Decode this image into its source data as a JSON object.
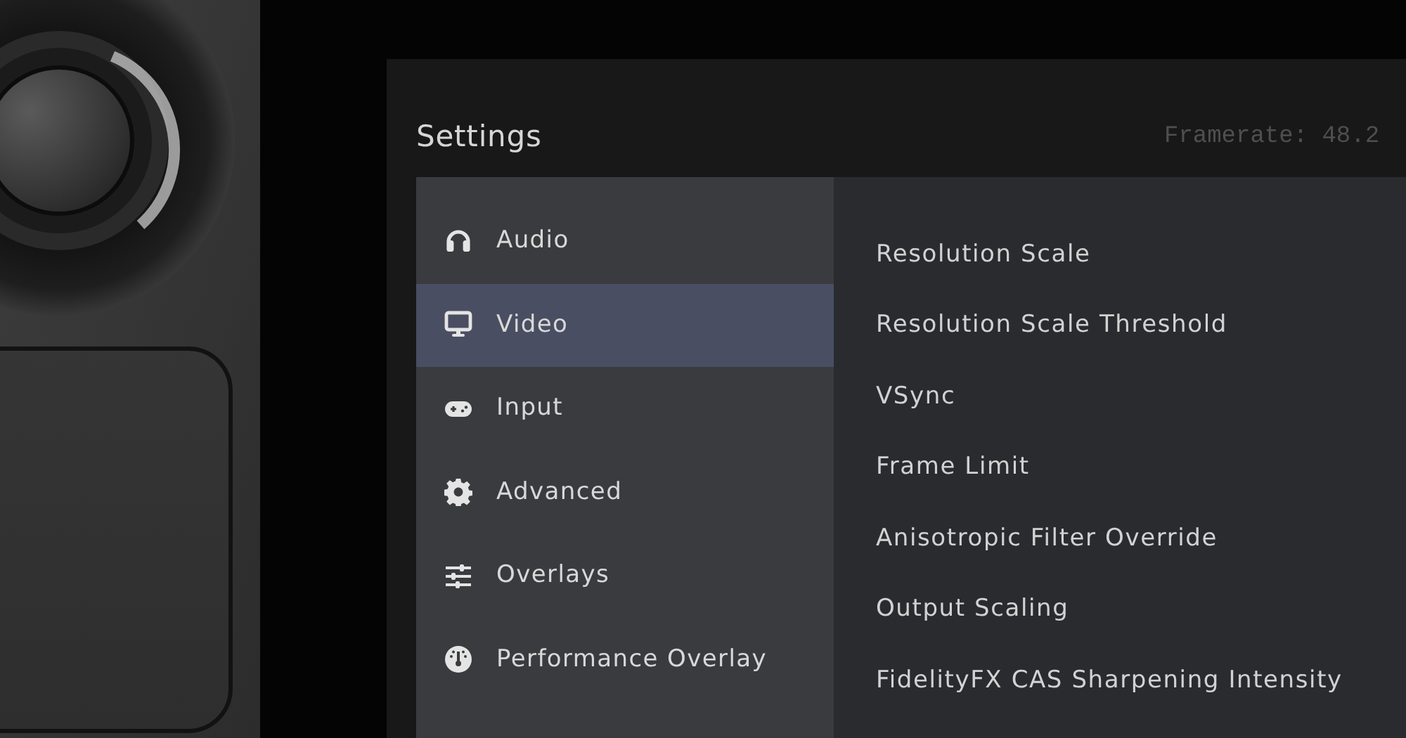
{
  "window": {
    "title": "Settings"
  },
  "overlay": {
    "framerate": "Framerate: 48.2"
  },
  "sidebar": {
    "items": [
      {
        "label": "Audio",
        "selected": false
      },
      {
        "label": "Video",
        "selected": true
      },
      {
        "label": "Input",
        "selected": false
      },
      {
        "label": "Advanced",
        "selected": false
      },
      {
        "label": "Overlays",
        "selected": false
      },
      {
        "label": "Performance Overlay",
        "selected": false
      }
    ]
  },
  "options": [
    {
      "label": "Resolution Scale"
    },
    {
      "label": "Resolution Scale Threshold"
    },
    {
      "label": "VSync"
    },
    {
      "label": "Frame Limit"
    },
    {
      "label": "Anisotropic Filter Override"
    },
    {
      "label": "Output Scaling"
    },
    {
      "label": "FidelityFX CAS Sharpening Intensity"
    }
  ]
}
